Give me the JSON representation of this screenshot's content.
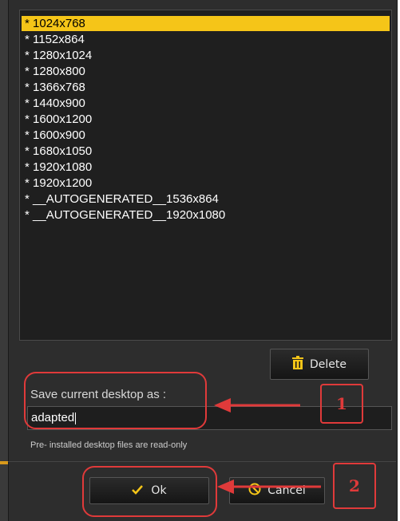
{
  "resolutions": {
    "items": [
      {
        "label": "* 1024x768",
        "selected": true
      },
      {
        "label": "* 1152x864",
        "selected": false
      },
      {
        "label": "* 1280x1024",
        "selected": false
      },
      {
        "label": "* 1280x800",
        "selected": false
      },
      {
        "label": "* 1366x768",
        "selected": false
      },
      {
        "label": "* 1440x900",
        "selected": false
      },
      {
        "label": "* 1600x1200",
        "selected": false
      },
      {
        "label": "* 1600x900",
        "selected": false
      },
      {
        "label": "* 1680x1050",
        "selected": false
      },
      {
        "label": "* 1920x1080",
        "selected": false
      },
      {
        "label": "* 1920x1200",
        "selected": false
      },
      {
        "label": "* __AUTOGENERATED__1536x864",
        "selected": false
      },
      {
        "label": "* __AUTOGENERATED__1920x1080",
        "selected": false
      }
    ]
  },
  "buttons": {
    "delete_label": "Delete",
    "ok_label": "Ok",
    "cancel_label": "Cancel"
  },
  "save": {
    "label": "Save current desktop as :",
    "value": "adapted"
  },
  "hint": "Pre- installed desktop files are read-only",
  "annotations": {
    "step1": "1",
    "step2": "2"
  },
  "colors": {
    "accent": "#f5c518",
    "annotation": "#e03a3a",
    "dialog_bg": "#2d2d2d"
  },
  "icons": {
    "delete": "trash-icon",
    "ok": "checkmark-icon",
    "cancel": "cancel-circle-icon"
  }
}
